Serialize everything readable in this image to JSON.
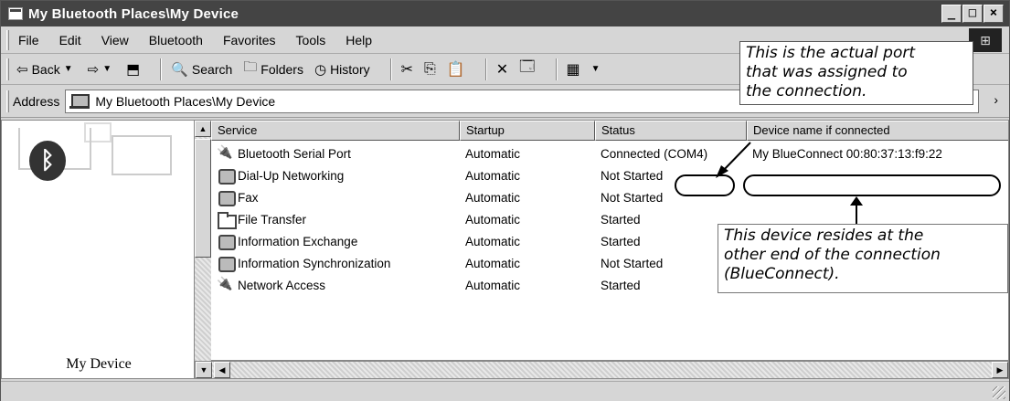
{
  "window": {
    "title": "My Bluetooth Places\\My Device",
    "controls": [
      "_",
      "□",
      "×"
    ],
    "logo_icon": "windows-logo-icon"
  },
  "menu": [
    {
      "label": "File"
    },
    {
      "label": "Edit"
    },
    {
      "label": "View"
    },
    {
      "label": "Bluetooth"
    },
    {
      "label": "Favorites"
    },
    {
      "label": "Tools"
    },
    {
      "label": "Help"
    }
  ],
  "toolbar": {
    "back": "Back",
    "search": "Search",
    "folders": "Folders",
    "history": "History"
  },
  "address": {
    "label": "Address",
    "value": "My Bluetooth Places\\My Device"
  },
  "left_pane": {
    "device_label": "My Device"
  },
  "list": {
    "headers": [
      "Service",
      "Startup",
      "Status",
      "Device name if connected"
    ],
    "rows": [
      {
        "service": "Bluetooth Serial Port",
        "startup": "Automatic",
        "status": "Connected",
        "port": "(COM4)",
        "device": "My BlueConnect 00:80:37:13:f9:22",
        "icon": "plug"
      },
      {
        "service": "Dial-Up Networking",
        "startup": "Automatic",
        "status": "Not Started",
        "port": "",
        "device": "",
        "icon": "generic"
      },
      {
        "service": "Fax",
        "startup": "Automatic",
        "status": "Not Started",
        "port": "",
        "device": "",
        "icon": "generic"
      },
      {
        "service": "File Transfer",
        "startup": "Automatic",
        "status": "Started",
        "port": "",
        "device": "",
        "icon": "folder"
      },
      {
        "service": "Information Exchange",
        "startup": "Automatic",
        "status": "Started",
        "port": "",
        "device": "",
        "icon": "generic"
      },
      {
        "service": "Information Synchronization",
        "startup": "Automatic",
        "status": "Not Started",
        "port": "",
        "device": "",
        "icon": "generic"
      },
      {
        "service": "Network Access",
        "startup": "Automatic",
        "status": "Started",
        "port": "",
        "device": "",
        "icon": "plug"
      }
    ]
  },
  "annotations": {
    "port": "This is the actual port that was assigned to the connection.",
    "port_lines": [
      "This is the actual port",
      "that was assigned to",
      "the connection."
    ],
    "device_lines": [
      "This device resides at the",
      "other end of the connection",
      "(BlueConnect)."
    ]
  }
}
